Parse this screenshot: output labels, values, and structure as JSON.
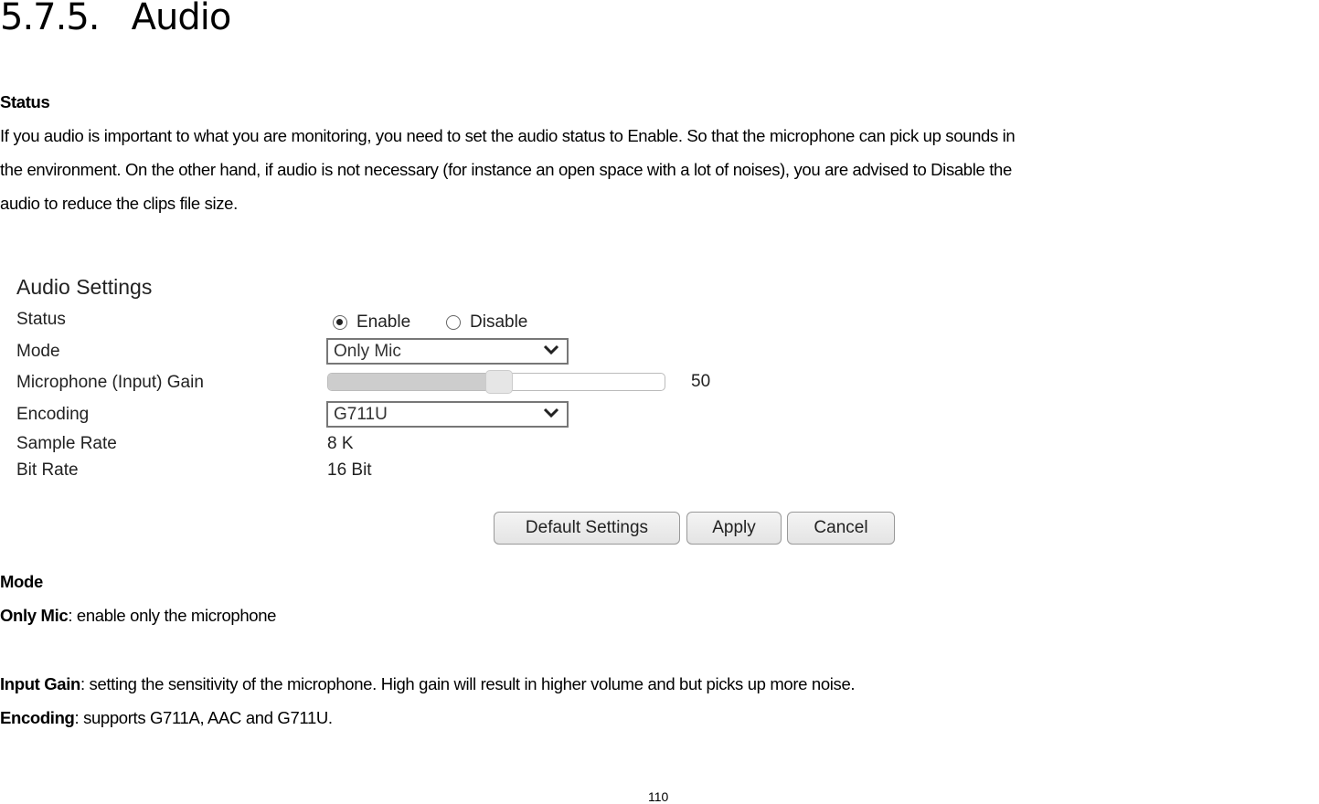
{
  "section": {
    "number": "5.7.5.",
    "title": "Audio"
  },
  "status_section": {
    "heading": "Status",
    "lines": [
      "If you audio is important to what you are monitoring, you need to set the audio status to Enable. So that the microphone can pick up sounds in",
      "the environment. On the other hand, if audio is not necessary (for instance an open space with a lot of noises), you are advised to Disable the",
      "audio to reduce the clips file size."
    ]
  },
  "audio_settings": {
    "title": "Audio Settings",
    "labels": {
      "status": "Status",
      "mode": "Mode",
      "gain": "Microphone (Input) Gain",
      "encoding": "Encoding",
      "sample_rate": "Sample Rate",
      "bit_rate": "Bit Rate"
    },
    "status_options": [
      {
        "label": "Enable",
        "checked": true
      },
      {
        "label": "Disable",
        "checked": false
      }
    ],
    "mode_value": "Only Mic",
    "gain_value": "50",
    "gain_fraction": 0.5,
    "encoding_value": "G711U",
    "sample_rate_value": "8 K",
    "bit_rate_value": "16 Bit",
    "buttons": {
      "default": "Default Settings",
      "apply": "Apply",
      "cancel": "Cancel"
    }
  },
  "mode_section": {
    "heading": "Mode",
    "only_mic_term": "Only Mic",
    "only_mic_desc": ": enable only the microphone",
    "input_gain_term": "Input Gain",
    "input_gain_desc": ": setting the sensitivity of the microphone. High gain will result in higher volume and but picks up more noise.",
    "encoding_term": "Encoding",
    "encoding_desc": ": supports G711A, AAC and G711U."
  },
  "footer": {
    "page_number": "110"
  }
}
